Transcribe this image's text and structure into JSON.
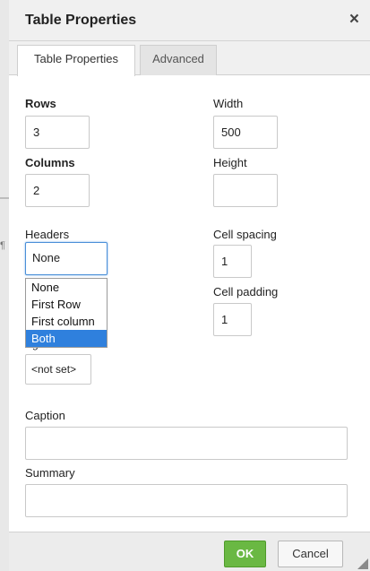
{
  "dialog": {
    "title": "Table Properties",
    "close_glyph": "×",
    "tabs": [
      {
        "label": "Table Properties",
        "active": true
      },
      {
        "label": "Advanced",
        "active": false
      }
    ]
  },
  "left_edge_glyph": "¶",
  "fields": {
    "rows": {
      "label": "Rows",
      "value": "3"
    },
    "columns": {
      "label": "Columns",
      "value": "2"
    },
    "width": {
      "label": "Width",
      "value": "500"
    },
    "height": {
      "label": "Height",
      "value": ""
    },
    "headers": {
      "label": "Headers",
      "value": "None",
      "options": [
        "None",
        "First Row",
        "First column",
        "Both"
      ],
      "highlighted": "Both"
    },
    "cell_spacing": {
      "label": "Cell spacing",
      "value": "1"
    },
    "cell_padding": {
      "label": "Cell padding",
      "value": "1"
    },
    "alignment": {
      "label_fragment": "g",
      "value": "<not set>"
    },
    "caption": {
      "label": "Caption",
      "value": ""
    },
    "summary": {
      "label": "Summary",
      "value": ""
    }
  },
  "footer": {
    "ok_label": "OK",
    "cancel_label": "Cancel"
  },
  "colors": {
    "ok_green": "#6ab843",
    "selection_blue": "#2f80dd",
    "focus_border": "#4a8fd8"
  }
}
